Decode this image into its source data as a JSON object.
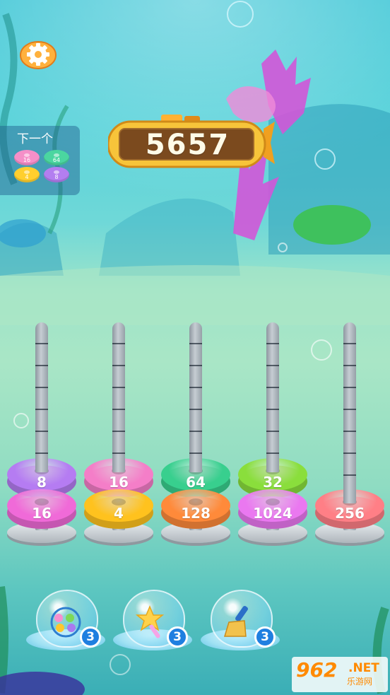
{
  "score": "5657",
  "next_panel": {
    "title": "下一个",
    "rings": [
      {
        "value": "16",
        "color": "#f58fc8"
      },
      {
        "value": "64",
        "color": "#4bd6a0"
      },
      {
        "value": "4",
        "color": "#ffcf2e"
      },
      {
        "value": "8",
        "color": "#b37ef0"
      }
    ]
  },
  "poles": [
    {
      "rings": [
        {
          "value": "16",
          "color": "#f06ad8"
        },
        {
          "value": "8",
          "color": "#b57cf2"
        }
      ]
    },
    {
      "rings": [
        {
          "value": "4",
          "color": "#ffc21e"
        },
        {
          "value": "16",
          "color": "#f47ec8"
        }
      ]
    },
    {
      "rings": [
        {
          "value": "128",
          "color": "#ff8a3a"
        },
        {
          "value": "64",
          "color": "#38cf8e"
        }
      ]
    },
    {
      "rings": [
        {
          "value": "1024",
          "color": "#ea78f0"
        },
        {
          "value": "32",
          "color": "#8ade3c"
        }
      ]
    },
    {
      "rings": [
        {
          "value": "256",
          "color": "#ff7f86"
        }
      ]
    }
  ],
  "tools": [
    {
      "name": "shuffle",
      "icon": "shuffle-rings-icon",
      "count": "3"
    },
    {
      "name": "magic-wand",
      "icon": "star-wand-icon",
      "count": "3"
    },
    {
      "name": "brush",
      "icon": "brush-icon",
      "count": "3"
    }
  ],
  "watermark": {
    "logo": "962",
    "net": ".NET",
    "sub": "乐游网"
  }
}
